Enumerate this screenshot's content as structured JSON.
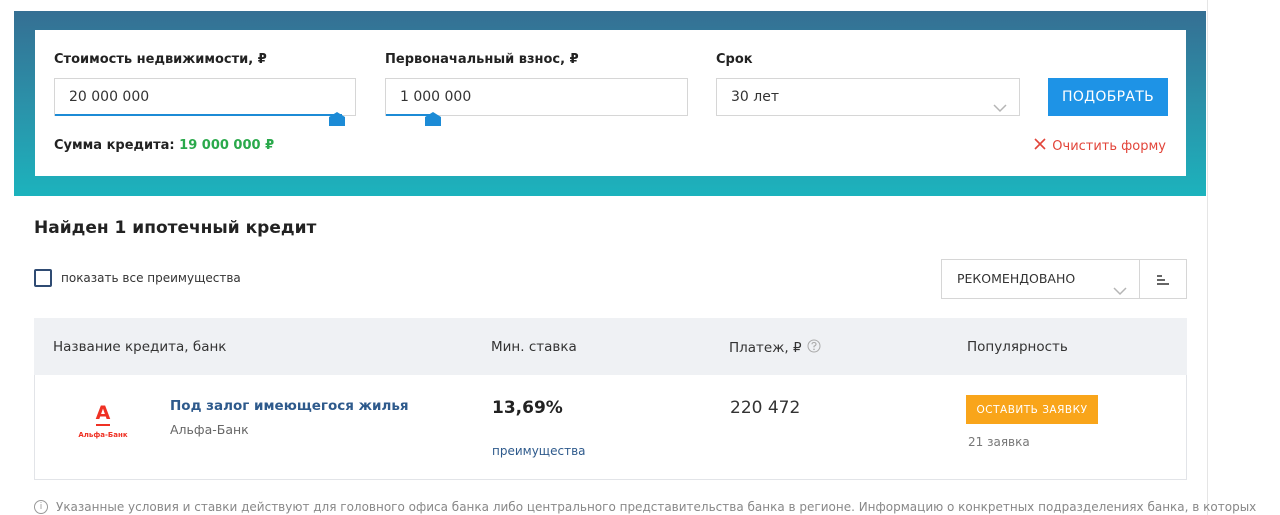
{
  "filter": {
    "property_cost_label": "Стоимость недвижимости, ₽",
    "property_cost_value": "20 000 000",
    "down_payment_label": "Первоначальный взнос, ₽",
    "down_payment_value": "1 000 000",
    "term_label": "Срок",
    "term_value": "30 лет",
    "submit_label": "ПОДОБРАТЬ",
    "loan_sum_label": "Сумма кредита:",
    "loan_sum_value": "19 000 000 ₽",
    "clear_label": "Очистить форму"
  },
  "results": {
    "title": "Найден 1 ипотечный кредит",
    "show_all_perks_label": "показать все преимущества",
    "sort_value": "РЕКОМЕНДОВАНО",
    "columns": [
      "Название кредита, банк",
      "Мин. ставка",
      "Платеж, ₽",
      "Популярность"
    ],
    "items": [
      {
        "logo_letter": "А",
        "logo_name": "Альфа-Банк",
        "credit_name": "Под залог имеющегося жилья",
        "bank_name": "Альфа-Банк",
        "rate": "13,69%",
        "perks_label": "преимущества",
        "payment": "220 472",
        "apply_label": "ОСТАВИТЬ ЗАЯВКУ",
        "applications": "21 заявка"
      }
    ],
    "footnote": "Указанные условия и ставки действуют для головного офиса банка либо центрального представительства банка в регионе. Информацию о конкретных подразделениях банка, в которых"
  },
  "colors": {
    "accent": "#1e93e6",
    "success": "#2aa94b",
    "danger": "#e2453a",
    "apply": "#f9a51a",
    "link": "#2e5a8c"
  },
  "icons": [
    "chevron-down-icon",
    "close-icon",
    "sort-icon",
    "question-icon",
    "info-icon",
    "slider-thumb-icon"
  ]
}
